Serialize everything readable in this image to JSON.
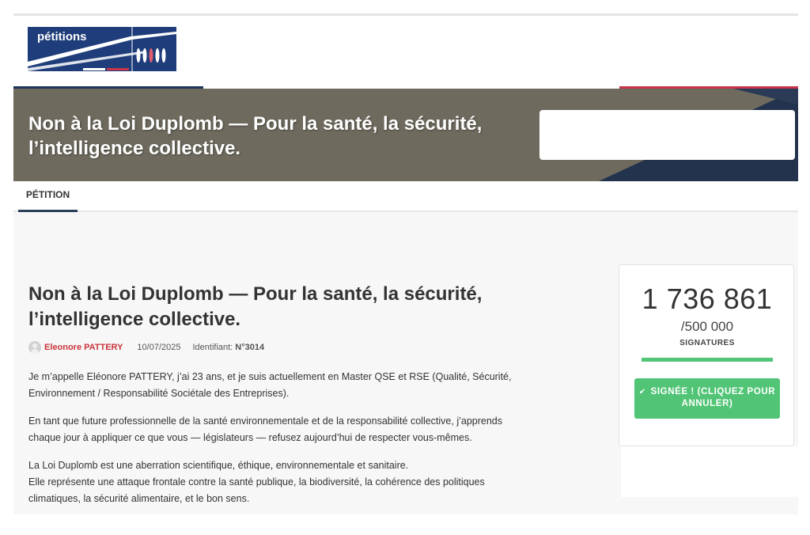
{
  "logo": {
    "text": "pétitions"
  },
  "banner": {
    "title": "Non à la Loi Duplomb — Pour la santé, la sécurité, l’intelligence collective."
  },
  "tabs": [
    {
      "label": "PÉTITION"
    }
  ],
  "petition": {
    "title": "Non à la Loi Duplomb — Pour la santé, la sécurité, l’intelligence collective.",
    "author": "Eleonore PATTERY",
    "date": "10/07/2025",
    "identifier_label": "Identifiant:",
    "identifier_value": "N°3014",
    "paragraphs": [
      "Je m’appelle Eléonore PATTERY, j’ai 23 ans, et je suis actuellement en Master QSE et RSE (Qualité, Sécurité, Environnement / Responsabilité Sociétale des Entreprises).",
      "En tant que future professionnelle de la santé environnementale et de la responsabilité collective, j’apprends chaque jour à appliquer ce que vous — législateurs — refusez aujourd’hui de respecter vous-mêmes.",
      "La Loi Duplomb est une aberration scientifique, éthique, environnementale et sanitaire.",
      "Elle représente une attaque frontale contre la santé publique, la biodiversité, la cohérence des politiques climatiques, la sécurité alimentaire, et le bon sens."
    ]
  },
  "counter": {
    "count": "1 736 861",
    "goal": "/500 000",
    "label": "SIGNATURES",
    "progress": 1.0,
    "button_label": "SIGNÉE ! (CLIQUEZ POUR ANNULER)"
  },
  "colors": {
    "navy": "#1f3558",
    "accent_red": "#c8363c",
    "success_green": "#52c476",
    "banner_bg": "#6e6a5e"
  }
}
